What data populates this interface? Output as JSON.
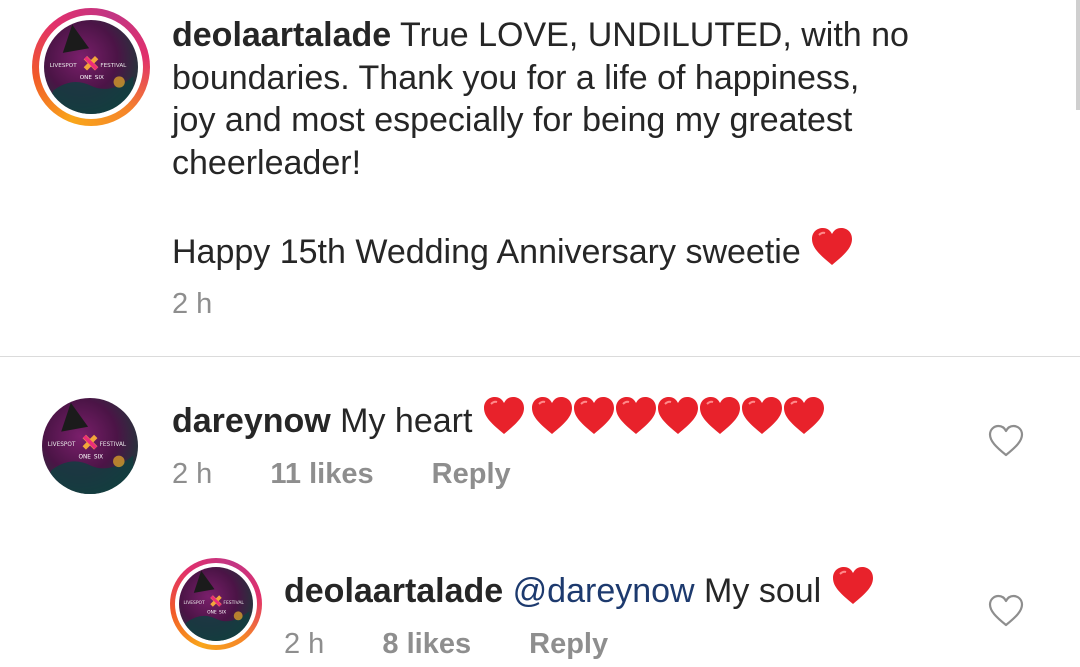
{
  "post_comment": {
    "username": "deolaartalade",
    "text_line1": " True LOVE, UNDILUTED, with no",
    "text_line2": "boundaries. Thank you for a life of happiness,",
    "text_line3": "joy and most especially for being my greatest",
    "text_line4": "cheerleader!",
    "text_line5": "Happy 15th Wedding Anniversary sweetie",
    "time": "2 h"
  },
  "comment": {
    "username": "dareynow",
    "text": " My heart",
    "heart_count": 8,
    "time": "2 h",
    "likes": "11 likes",
    "reply": "Reply"
  },
  "reply": {
    "username": "deolaartalade",
    "mention": "@dareynow",
    "text": " My soul",
    "time": "2 h",
    "likes": "8 likes",
    "reply": "Reply"
  },
  "avatar_logo": {
    "left_word": "LIVESPOT",
    "right_word": "FESTIVAL",
    "badge_left": "ONE",
    "badge_right": "SIX"
  },
  "colors": {
    "heart": "#e8222b",
    "meta_gray": "#8e8e8e",
    "mention_blue": "#1d3a6e"
  },
  "icons": [
    "heart-emoji",
    "heart-outline-icon"
  ]
}
